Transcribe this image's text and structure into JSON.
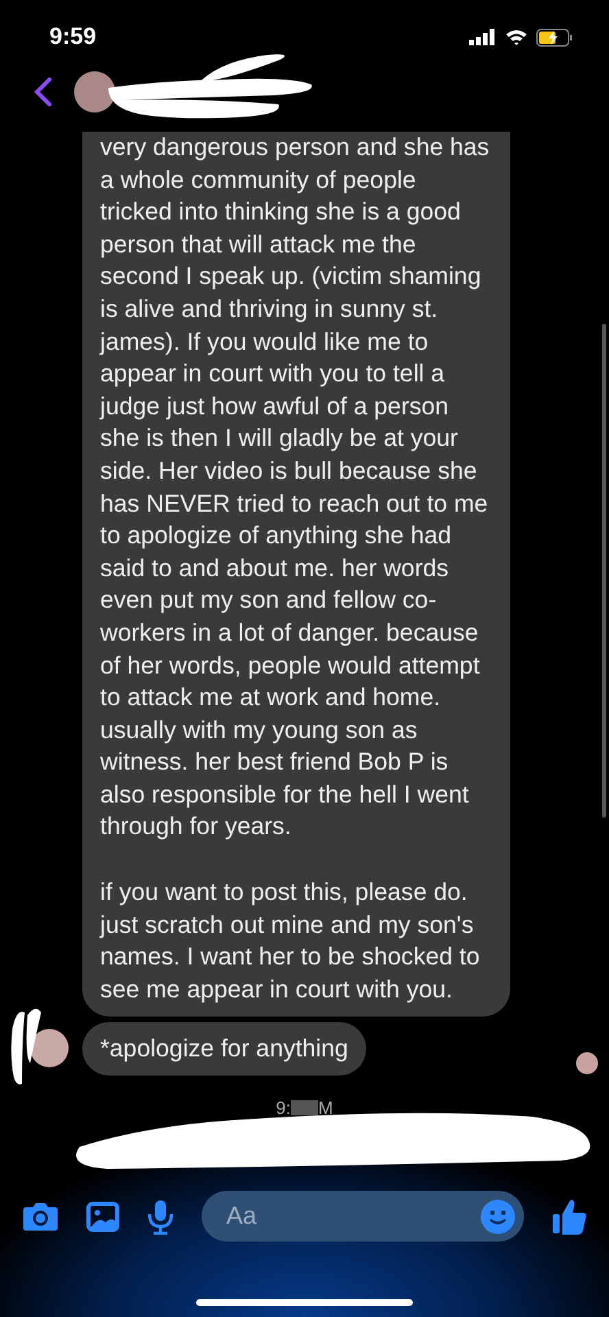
{
  "status_bar": {
    "time": "9:59"
  },
  "messages": [
    {
      "paragraphs": [
        "very dangerous person and she has a whole community of people tricked into thinking she is a good person that will attack me the second I speak up. (victim shaming is alive and thriving in sunny st. james). If you would like me to appear in court with you to tell a judge just how awful of a person she is then I will gladly be at your side. Her video is bull because she has NEVER tried to reach out to me to apologize of anything she had said to and about me. her words even put my son and fellow co-workers in a lot of danger. because of her words, people would attempt to attack me at work and home. usually with my young son as witness. her best friend Bob P is also responsible for the hell I went through for years.",
        "if you want to post this, please do. just scratch out mine and my son's names. I want her to be shocked to see me appear in court with you."
      ]
    },
    {
      "paragraphs": [
        "*apologize for anything"
      ]
    }
  ],
  "timestamp": {
    "visible_start": "9:",
    "visible_end": "M"
  },
  "composer": {
    "placeholder": "Aa"
  }
}
